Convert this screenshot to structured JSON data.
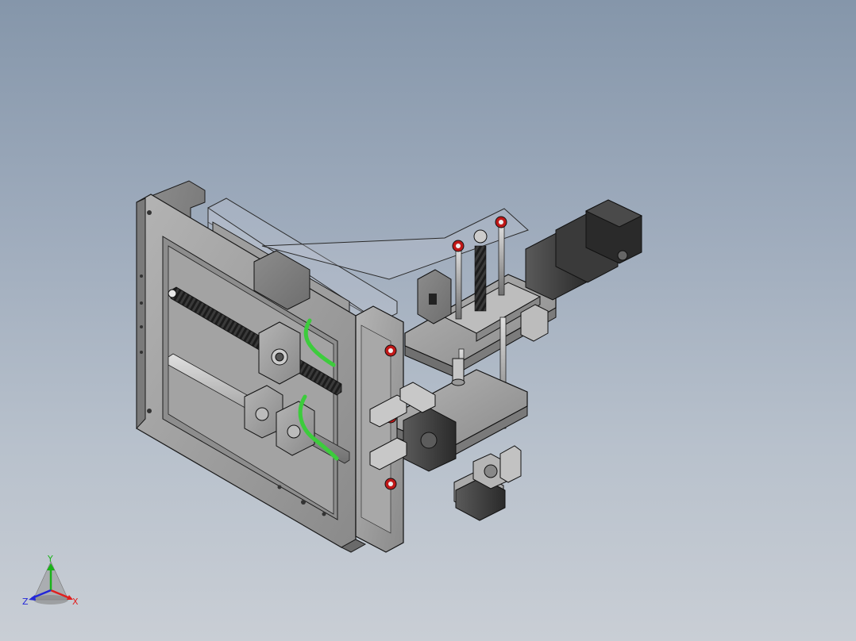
{
  "viewport": {
    "background_top": "#8596aa",
    "background_bottom": "#c9ced5"
  },
  "model": {
    "part_color": "#9a9a9a",
    "edge_color": "#1a1a1a",
    "cable_color": "#3ccc3c",
    "bolt_head_color": "#c01818",
    "motor_color": "#3a3a3a",
    "leadscrew_color": "#2b2b2b"
  },
  "triad": {
    "x_label": "X",
    "y_label": "Y",
    "z_label": "Z",
    "x_color": "#e01f1f",
    "y_color": "#19b319",
    "z_color": "#2226d8"
  }
}
